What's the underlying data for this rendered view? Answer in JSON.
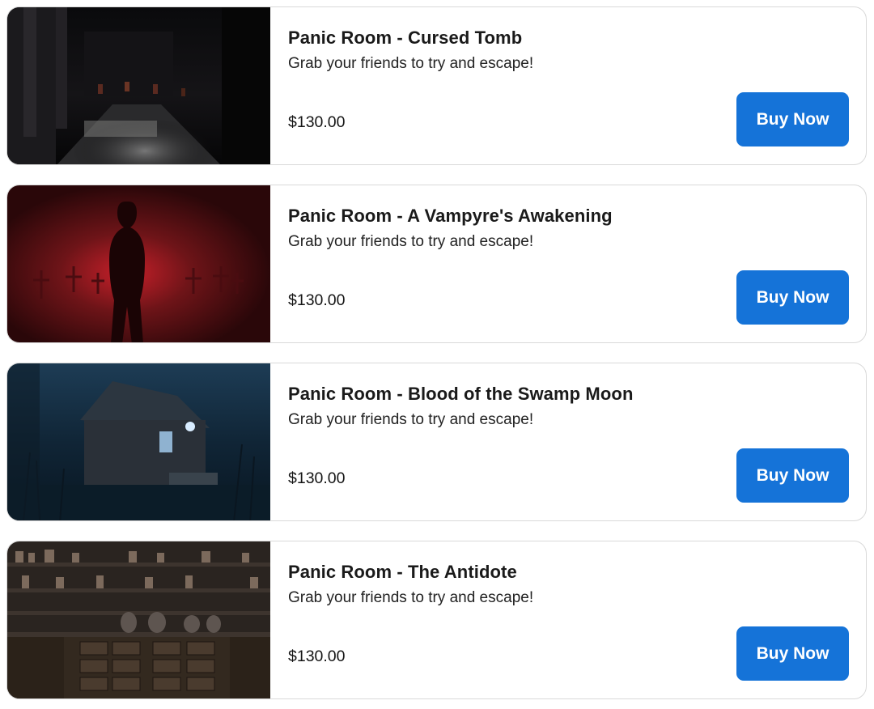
{
  "products": [
    {
      "title": "Panic Room - Cursed Tomb",
      "description": "Grab your friends to try and escape!",
      "price": "$130.00",
      "button_label": "Buy Now",
      "image": "cursed-tomb-corridor-image"
    },
    {
      "title": "Panic Room - A Vampyre's Awakening",
      "description": "Grab your friends to try and escape!",
      "price": "$130.00",
      "button_label": "Buy Now",
      "image": "vampyre-silhouette-crosses-image"
    },
    {
      "title": "Panic Room - Blood of the Swamp Moon",
      "description": "Grab your friends to try and escape!",
      "price": "$130.00",
      "button_label": "Buy Now",
      "image": "swamp-cabin-night-image"
    },
    {
      "title": "Panic Room - The Antidote",
      "description": "Grab your friends to try and escape!",
      "price": "$130.00",
      "button_label": "Buy Now",
      "image": "apothecary-shelves-image"
    }
  ],
  "colors": {
    "button": "#1573d8",
    "button_text": "#ffffff",
    "card_border": "#d9d9d9"
  }
}
